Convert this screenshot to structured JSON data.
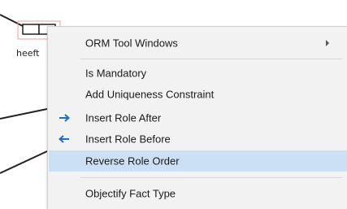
{
  "diagram": {
    "fact_label": "heeft"
  },
  "context_menu": {
    "items": [
      {
        "label": "ORM Tool Windows",
        "has_submenu": true,
        "icon": ""
      },
      {
        "label": "Is Mandatory",
        "has_submenu": false,
        "icon": ""
      },
      {
        "label": "Add Uniqueness Constraint",
        "has_submenu": false,
        "icon": ""
      },
      {
        "label": "Insert Role After",
        "has_submenu": false,
        "icon": "arrow-right-icon"
      },
      {
        "label": "Insert Role Before",
        "has_submenu": false,
        "icon": "arrow-left-icon"
      },
      {
        "label": "Reverse Role Order",
        "has_submenu": false,
        "icon": "",
        "highlighted": true
      },
      {
        "label": "Objectify Fact Type",
        "has_submenu": false,
        "icon": ""
      }
    ],
    "colors": {
      "menu_background": "#f2f2f2",
      "highlight": "#cce0f5",
      "arrow_icon": "#1f6fc4"
    }
  }
}
